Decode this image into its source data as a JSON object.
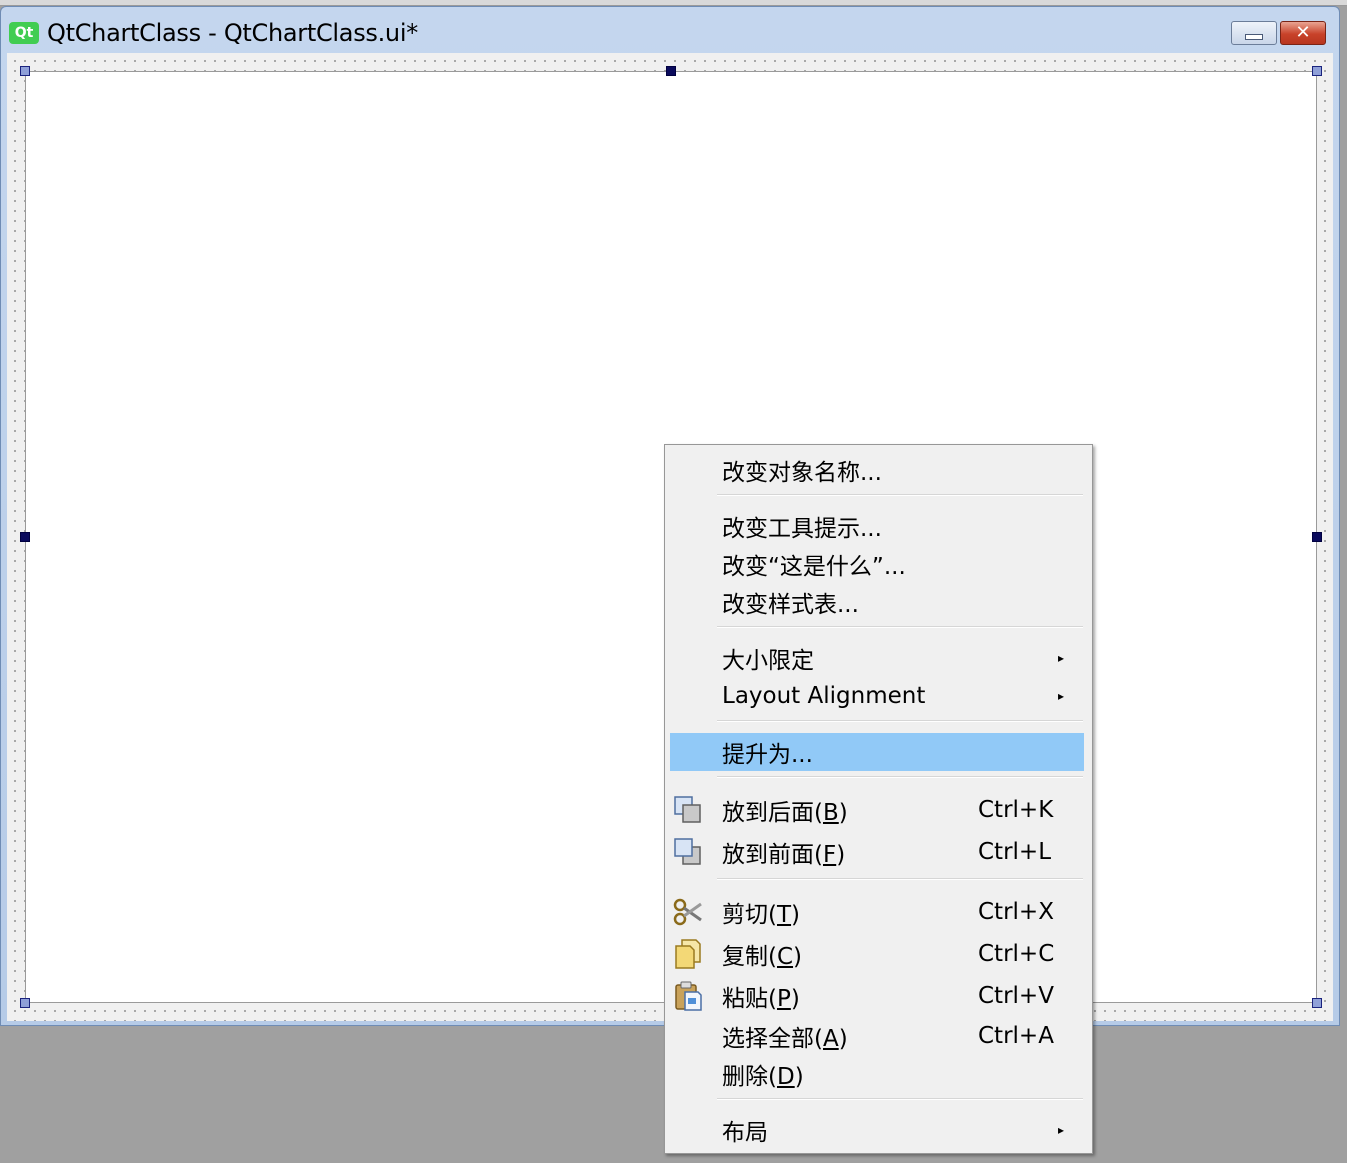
{
  "window": {
    "app_icon_text": "Qt",
    "title": "QtChartClass - QtChartClass.ui*",
    "minimize_symbol": "—",
    "close_symbol": "✕"
  },
  "context_menu": {
    "change_object_name": "改变对象名称...",
    "change_tooltip": "改变工具提示...",
    "change_whats_this": "改变“这是什么”...",
    "change_stylesheet": "改变样式表...",
    "size_constraints": "大小限定",
    "layout_alignment": "Layout Alignment",
    "promote_to": "提升为...",
    "send_to_back": {
      "label": "放到后面(",
      "mnemonic": "B",
      "suffix": ")",
      "shortcut": "Ctrl+K"
    },
    "bring_to_front": {
      "label": "放到前面(",
      "mnemonic": "F",
      "suffix": ")",
      "shortcut": "Ctrl+L"
    },
    "cut": {
      "label": "剪切(",
      "mnemonic": "T",
      "suffix": ")",
      "shortcut": "Ctrl+X"
    },
    "copy": {
      "label": "复制(",
      "mnemonic": "C",
      "suffix": ")",
      "shortcut": "Ctrl+C"
    },
    "paste": {
      "label": "粘贴(",
      "mnemonic": "P",
      "suffix": ")",
      "shortcut": "Ctrl+V"
    },
    "select_all": {
      "label": "选择全部(",
      "mnemonic": "A",
      "suffix": ")",
      "shortcut": "Ctrl+A"
    },
    "delete": {
      "label": "删除(",
      "mnemonic": "D",
      "suffix": ")"
    },
    "layout": "布局",
    "submenu_arrow": "▸",
    "icons": {
      "send_to_back": "send-to-back-icon",
      "bring_to_front": "bring-to-front-icon",
      "cut": "scissors-icon",
      "copy": "copy-icon",
      "paste": "paste-icon"
    }
  },
  "colors": {
    "highlight": "#91c9f7",
    "menu_background": "#f0f0f0",
    "desktop": "#a0a0a0",
    "qt_green": "#41cd52"
  }
}
